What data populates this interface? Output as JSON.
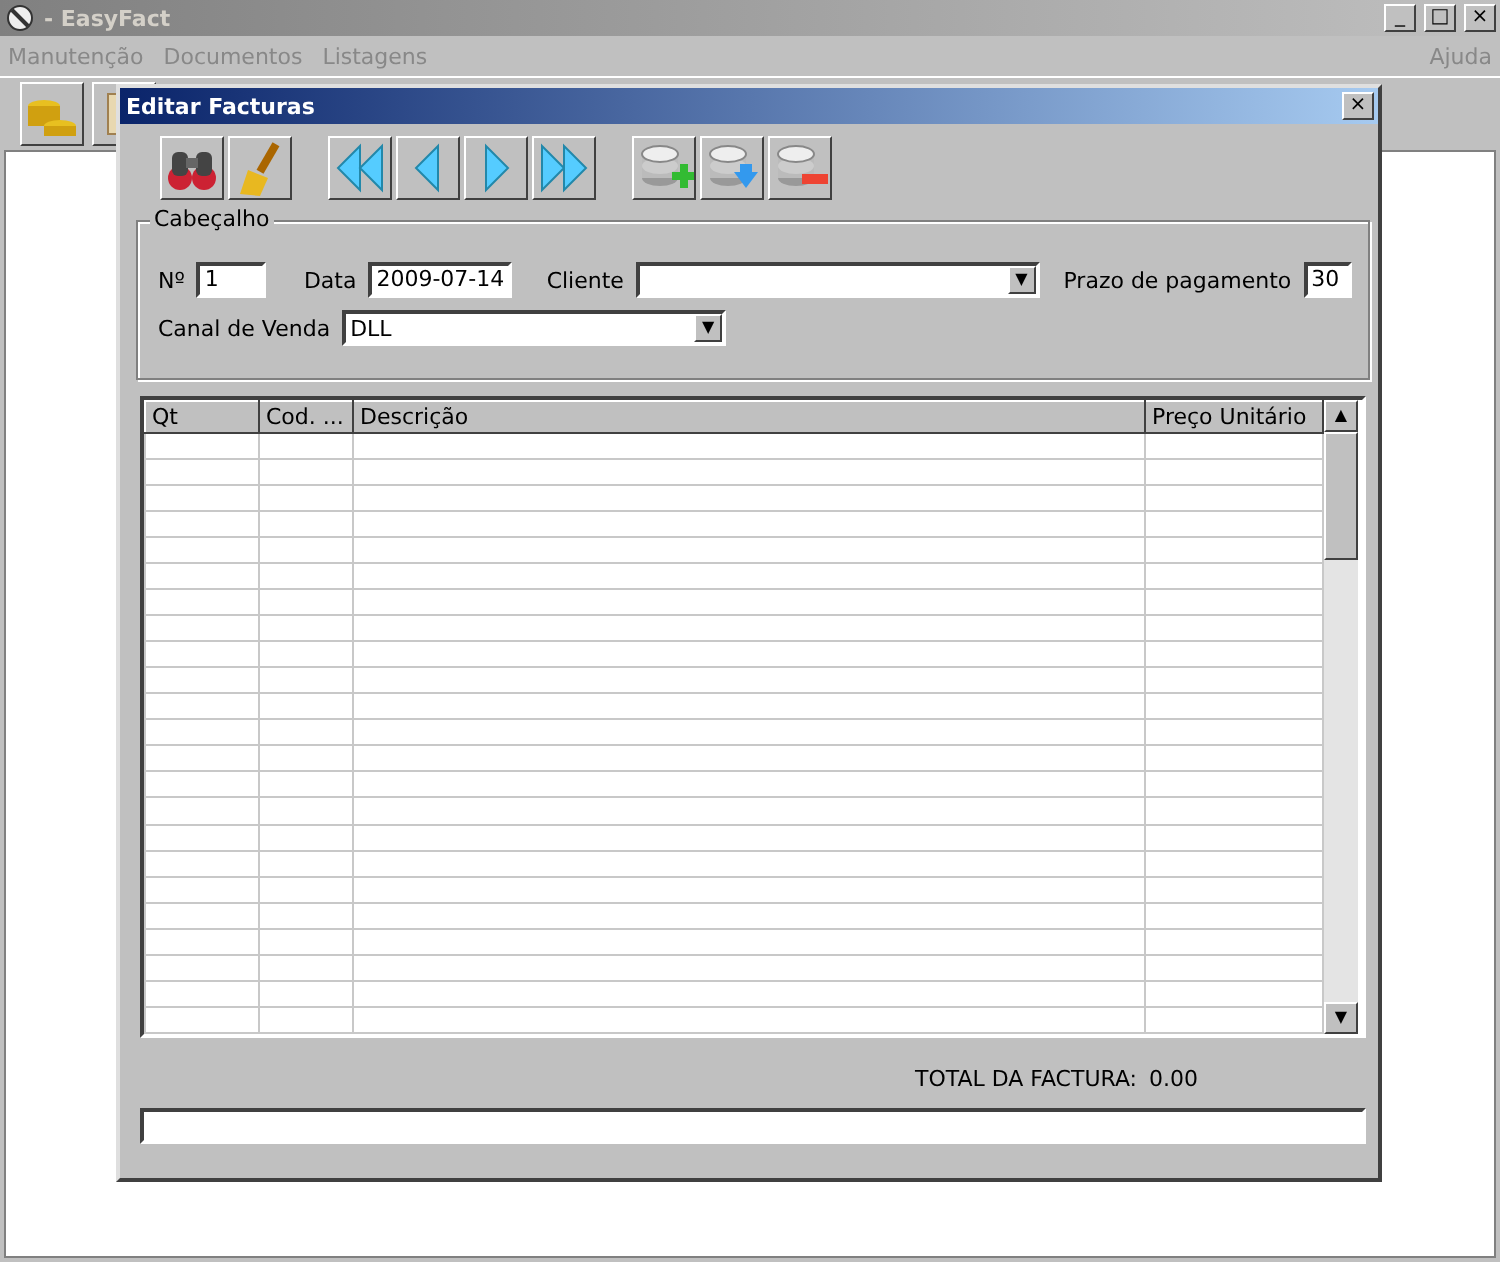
{
  "window": {
    "title": "- EasyFact",
    "controls": [
      "_",
      "□",
      "×"
    ]
  },
  "menu": {
    "items": [
      "Manutenção",
      "Documentos",
      "Listagens"
    ],
    "help": "Ajuda"
  },
  "dialog": {
    "title": "Editar Facturas",
    "close": "×"
  },
  "header": {
    "legend": "Cabeçalho",
    "number": {
      "label": "Nº",
      "value": "1"
    },
    "date": {
      "label": "Data",
      "value": "2009-07-14"
    },
    "client": {
      "label": "Cliente",
      "arrow": "▼"
    },
    "payment_term": {
      "label": "Prazo de pagamento",
      "value": "30"
    },
    "sales_channel": {
      "label": "Canal de Venda",
      "value": "DLL",
      "arrow": "▼"
    }
  },
  "table": {
    "columns": [
      "Qt",
      "Cod. ...",
      "Descrição",
      "Preço Unitário"
    ],
    "scroll_up": "▲",
    "scroll_down": "▼"
  },
  "total": {
    "label": "TOTAL DA FACTURA:",
    "value": "0.00"
  }
}
